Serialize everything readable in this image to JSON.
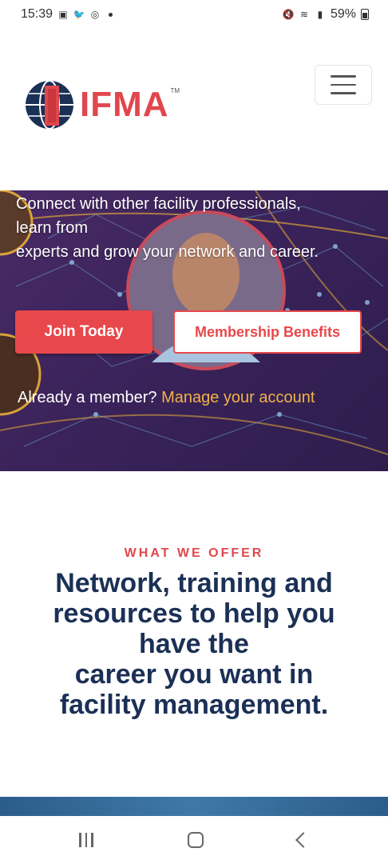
{
  "status_bar": {
    "time": "15:39",
    "battery": "59%"
  },
  "header": {
    "logo_text": "IFMA",
    "logo_tm": "TM"
  },
  "hero": {
    "text_line1": "Connect with other facility professionals,",
    "text_line2": "learn from",
    "text_line3": "experts and grow your network and career.",
    "join_label": "Join Today",
    "benefits_label": "Membership Benefits",
    "member_prefix": "Already a member? ",
    "member_link": "Manage your account"
  },
  "offer": {
    "eyebrow": "WHAT WE OFFER",
    "title_line1": "Network, training and",
    "title_line2": "resources to help you",
    "title_line3": "have the",
    "title_line4": "career you want in",
    "title_line5": "facility management."
  },
  "colors": {
    "brand_red": "#e0474c",
    "navy": "#1b3055",
    "link_gold": "#f2b24a",
    "hero_purple": "#3a235a"
  }
}
